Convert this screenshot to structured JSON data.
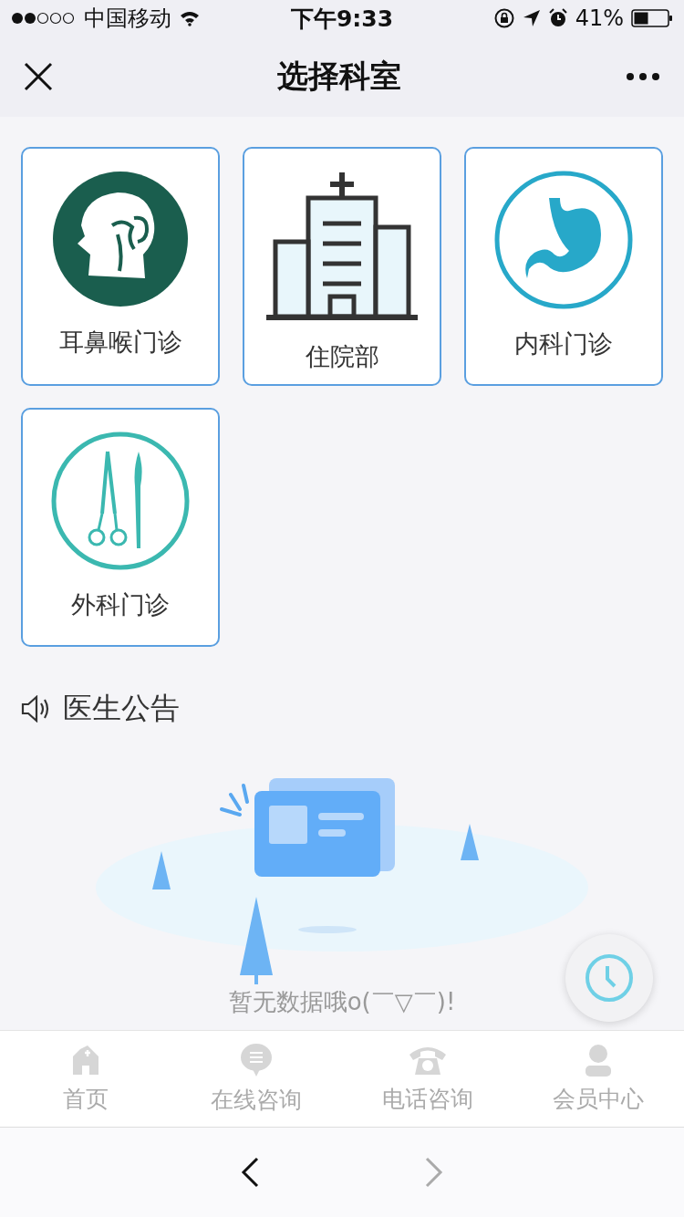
{
  "status_bar": {
    "carrier": "中国移动",
    "time": "下午9:33",
    "battery": "41%"
  },
  "nav": {
    "title": "选择科室"
  },
  "departments": [
    {
      "name": "耳鼻喉门诊",
      "kind": "ent"
    },
    {
      "name": "住院部",
      "kind": "inpatient"
    },
    {
      "name": "内科门诊",
      "kind": "internal"
    },
    {
      "name": "外科门诊",
      "kind": "surgery"
    }
  ],
  "notice": {
    "title": "医生公告",
    "empty_text": "暂无数据哦o(￣▽￣)!"
  },
  "tab_bar": [
    {
      "label": "首页",
      "selected": false
    },
    {
      "label": "在线咨询",
      "selected": false
    },
    {
      "label": "电话咨询",
      "selected": false
    },
    {
      "label": "会员中心",
      "selected": false
    }
  ],
  "browser_bar": {
    "back": {
      "disabled": false
    },
    "forward": {
      "disabled": true
    }
  }
}
